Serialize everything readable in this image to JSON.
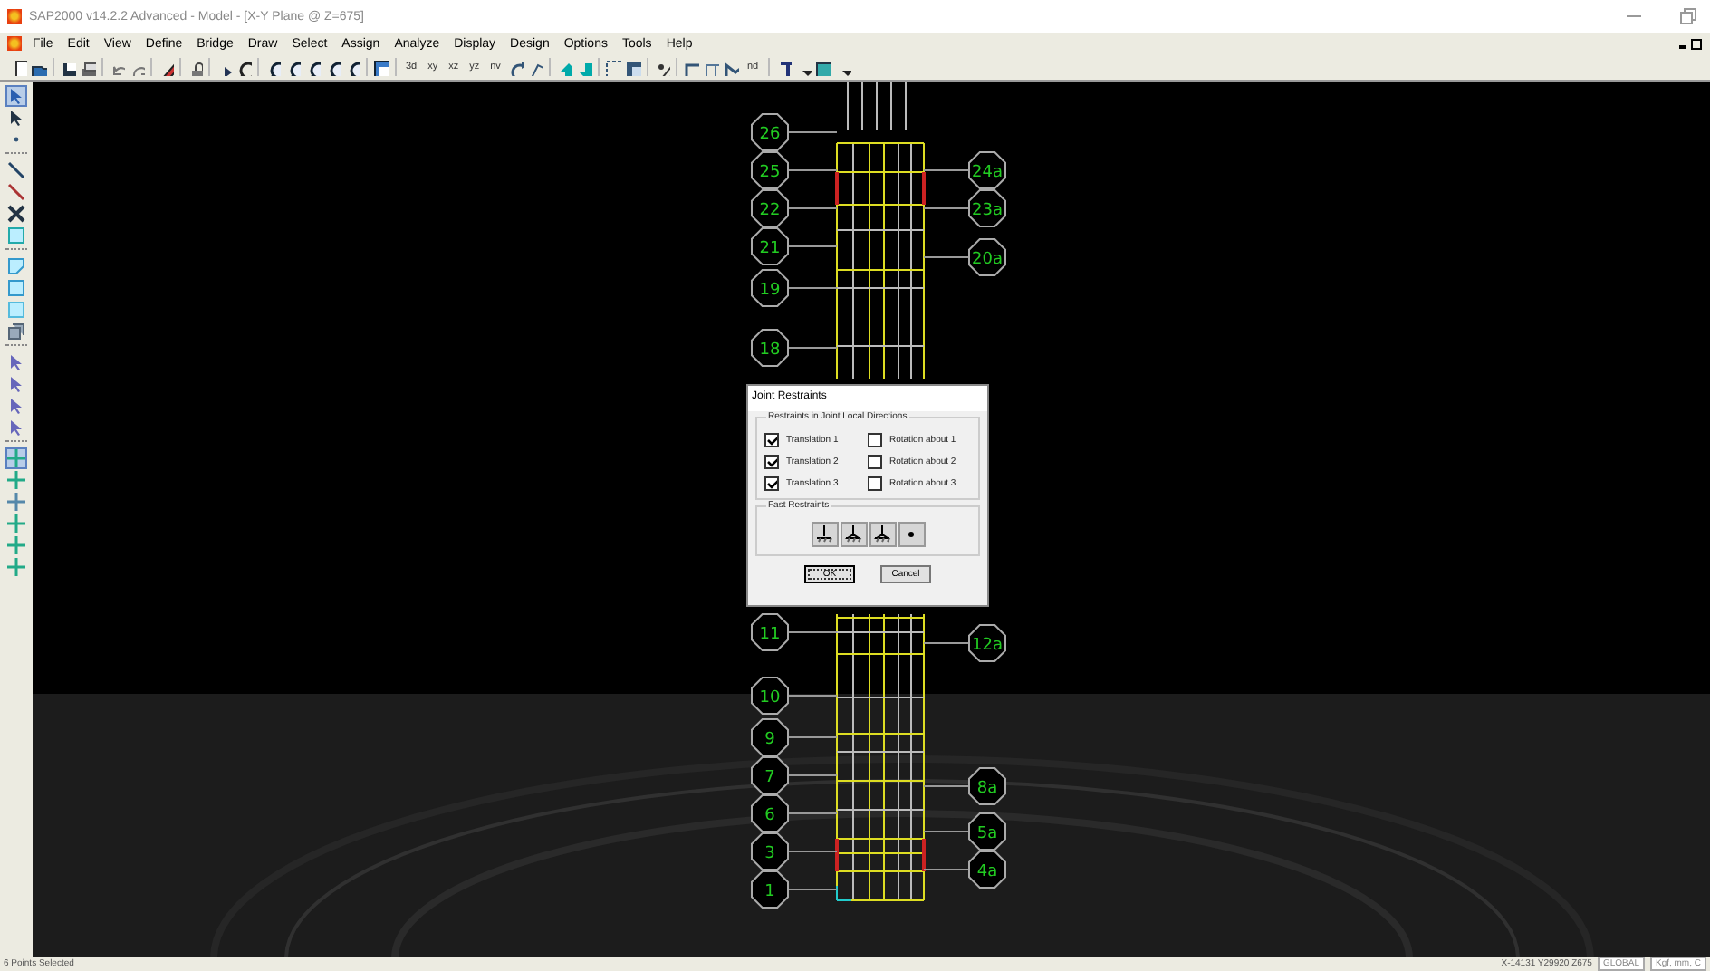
{
  "window": {
    "title": "SAP2000 v14.2.2 Advanced  - Model - [X-Y Plane @ Z=675]"
  },
  "menu": [
    "File",
    "Edit",
    "View",
    "Define",
    "Bridge",
    "Draw",
    "Select",
    "Assign",
    "Analyze",
    "Display",
    "Design",
    "Options",
    "Tools",
    "Help"
  ],
  "toolbar": {
    "view_buttons": [
      "3d",
      "xy",
      "xz",
      "yz",
      "nv"
    ],
    "section_button": "nd"
  },
  "canvas": {
    "left_grid_labels": [
      "26",
      "25",
      "22",
      "21",
      "19",
      "18",
      "11",
      "10",
      "9",
      "7",
      "6",
      "3",
      "1"
    ],
    "right_grid_labels": [
      "24a",
      "23a",
      "20a",
      "12a",
      "8a",
      "5a",
      "4a"
    ]
  },
  "dialog": {
    "title": "Joint Restraints",
    "group_title": "Restraints in Joint Local Directions",
    "restraints": [
      {
        "label": "Translation  1",
        "checked": true
      },
      {
        "label": "Rotation about  1",
        "checked": false
      },
      {
        "label": "Translation  2",
        "checked": true
      },
      {
        "label": "Rotation about  2",
        "checked": false
      },
      {
        "label": "Translation  3",
        "checked": true
      },
      {
        "label": "Rotation about  3",
        "checked": false
      }
    ],
    "fast_title": "Fast Restraints",
    "buttons": [
      "OK",
      "Cancel"
    ]
  },
  "status_bar": {
    "message": "6 Points Selected",
    "coordinates": "X-14131  Y29920  Z675",
    "coordinate_system": "GLOBAL",
    "units": "Kgf, mm, C"
  }
}
